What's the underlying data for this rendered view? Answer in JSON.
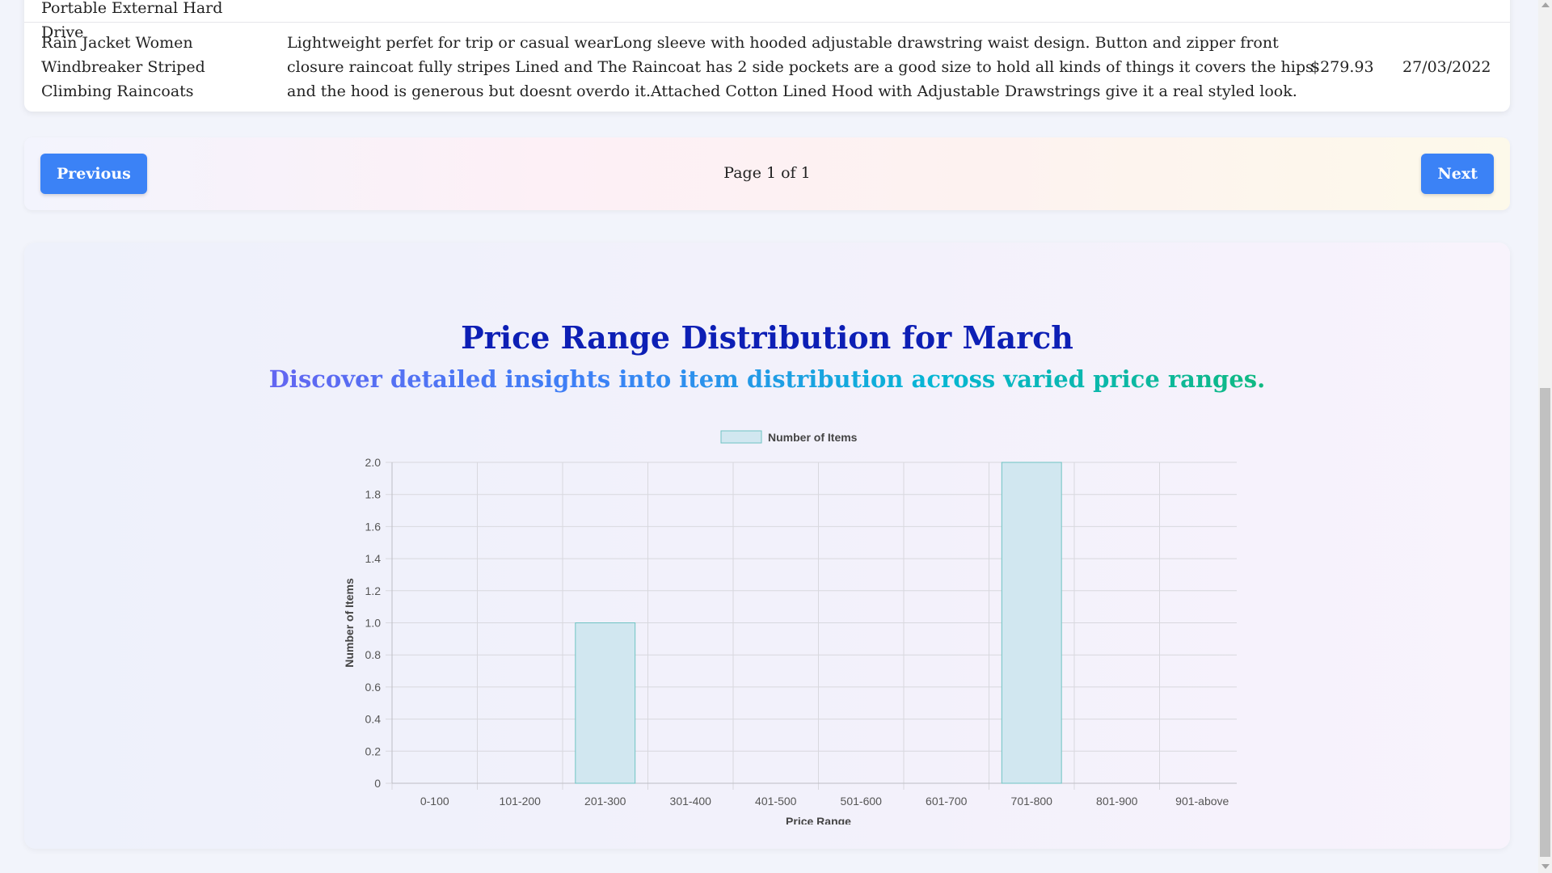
{
  "table": {
    "previous_row": {
      "name": "Portable External Hard Drive"
    },
    "row": {
      "name": "Rain Jacket Women Windbreaker Striped Climbing Raincoats",
      "description": "Lightweight perfet for trip or casual wearLong sleeve with hooded adjustable drawstring waist design. Button and zipper front closure raincoat fully stripes Lined and The Raincoat has 2 side pockets are a good size to hold all kinds of things it covers the hips and the hood is generous but doesnt overdo it.Attached Cotton Lined Hood with Adjustable Drawstrings give it a real styled look.",
      "price": "$279.93",
      "date": "27/03/2022"
    }
  },
  "pagination": {
    "previous_label": "Previous",
    "page_info": "Page 1 of 1",
    "next_label": "Next"
  },
  "chart": {
    "title": "Price Range Distribution for March",
    "subtitle": "Discover detailed insights into item distribution across varied price ranges."
  },
  "chart_data": {
    "type": "bar",
    "categories": [
      "0-100",
      "101-200",
      "201-300",
      "301-400",
      "401-500",
      "501-600",
      "601-700",
      "701-800",
      "801-900",
      "901-above"
    ],
    "series": [
      {
        "name": "Number of Items",
        "values": [
          0,
          0,
          1,
          0,
          0,
          0,
          0,
          2,
          0,
          0
        ]
      }
    ],
    "xlabel": "Price Range",
    "ylabel": "Number of Items",
    "ylim": [
      0,
      2
    ],
    "yticks": [
      "0",
      "0.2",
      "0.4",
      "0.6",
      "0.8",
      "1.0",
      "1.2",
      "1.4",
      "1.6",
      "1.8",
      "2.0"
    ],
    "grid": true,
    "legend_position": "top",
    "bar_fill": "#d1e7f0",
    "bar_stroke": "#6fc3c3"
  }
}
